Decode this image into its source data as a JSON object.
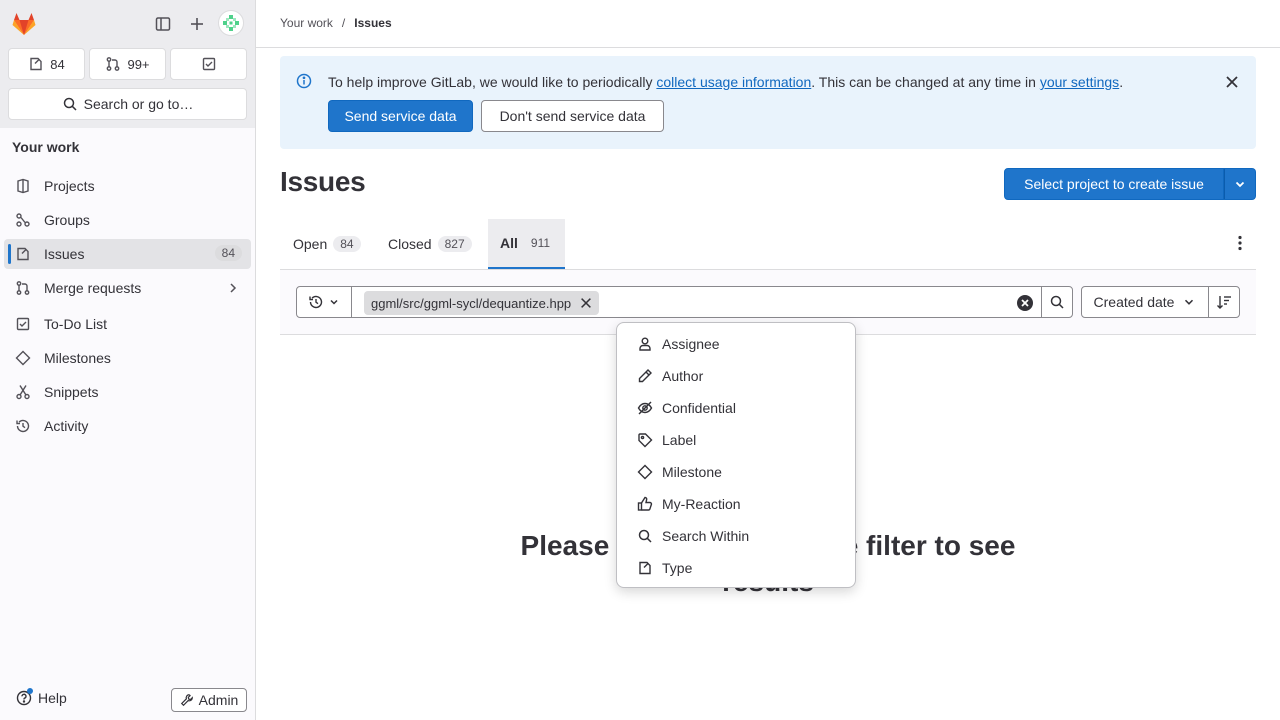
{
  "sidebar": {
    "counters": {
      "issues": "84",
      "merge_requests": "99+"
    },
    "search_label": "Search or go to…",
    "section_title": "Your work",
    "items": [
      {
        "label": "Projects"
      },
      {
        "label": "Groups"
      },
      {
        "label": "Issues",
        "badge": "84"
      },
      {
        "label": "Merge requests"
      },
      {
        "label": "To-Do List"
      },
      {
        "label": "Milestones"
      },
      {
        "label": "Snippets"
      },
      {
        "label": "Activity"
      }
    ],
    "help_label": "Help",
    "admin_label": "Admin"
  },
  "breadcrumb": {
    "parent": "Your work",
    "separator": "/",
    "current": "Issues"
  },
  "alert": {
    "text_before": "To help improve GitLab, we would like to periodically ",
    "link1": "collect usage information",
    "text_middle": ". This can be changed at any time in ",
    "link2": "your settings",
    "text_after": ".",
    "primary_btn": "Send service data",
    "secondary_btn": "Don't send service data"
  },
  "page": {
    "title": "Issues",
    "create_btn": "Select project to create issue"
  },
  "tabs": [
    {
      "label": "Open",
      "count": "84"
    },
    {
      "label": "Closed",
      "count": "827"
    },
    {
      "label": "All",
      "count": "911"
    }
  ],
  "filter": {
    "token": "ggml/src/ggml-sycl/dequantize.hpp",
    "sort_label": "Created date"
  },
  "empty_state": {
    "line1": "Please select at least one filter to see",
    "line2": "results"
  },
  "dropdown": {
    "items": [
      {
        "label": "Assignee",
        "icon": "user-icon"
      },
      {
        "label": "Author",
        "icon": "pencil-icon"
      },
      {
        "label": "Confidential",
        "icon": "eye-slash-icon"
      },
      {
        "label": "Label",
        "icon": "label-icon"
      },
      {
        "label": "Milestone",
        "icon": "milestone-icon"
      },
      {
        "label": "My-Reaction",
        "icon": "thumb-up-icon"
      },
      {
        "label": "Search Within",
        "icon": "search-icon"
      },
      {
        "label": "Type",
        "icon": "issue-type-icon"
      }
    ]
  },
  "colors": {
    "accent": "#1f75cb",
    "alert_bg": "#e9f3fc",
    "sidebar_bg": "#fbfafd"
  }
}
